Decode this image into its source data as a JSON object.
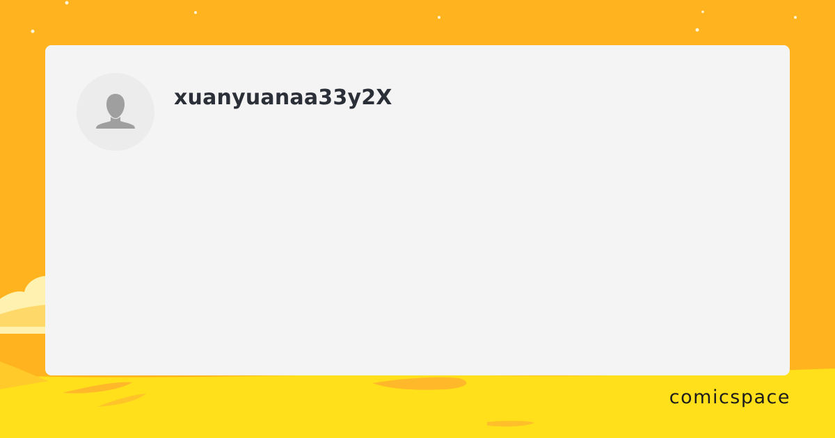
{
  "profile": {
    "username": "xuanyuanaa33y2X",
    "avatar_icon": "default-user-silhouette"
  },
  "brand": {
    "name": "comicspace"
  },
  "colors": {
    "background_orange": "#ffb31f",
    "ground_yellow": "#ffe01a",
    "card_bg": "#f4f4f4",
    "avatar_bg": "#ececec",
    "avatar_icon": "#9f9f9f",
    "username_text": "#2b2f38",
    "brand_text": "#1c1c1c"
  }
}
